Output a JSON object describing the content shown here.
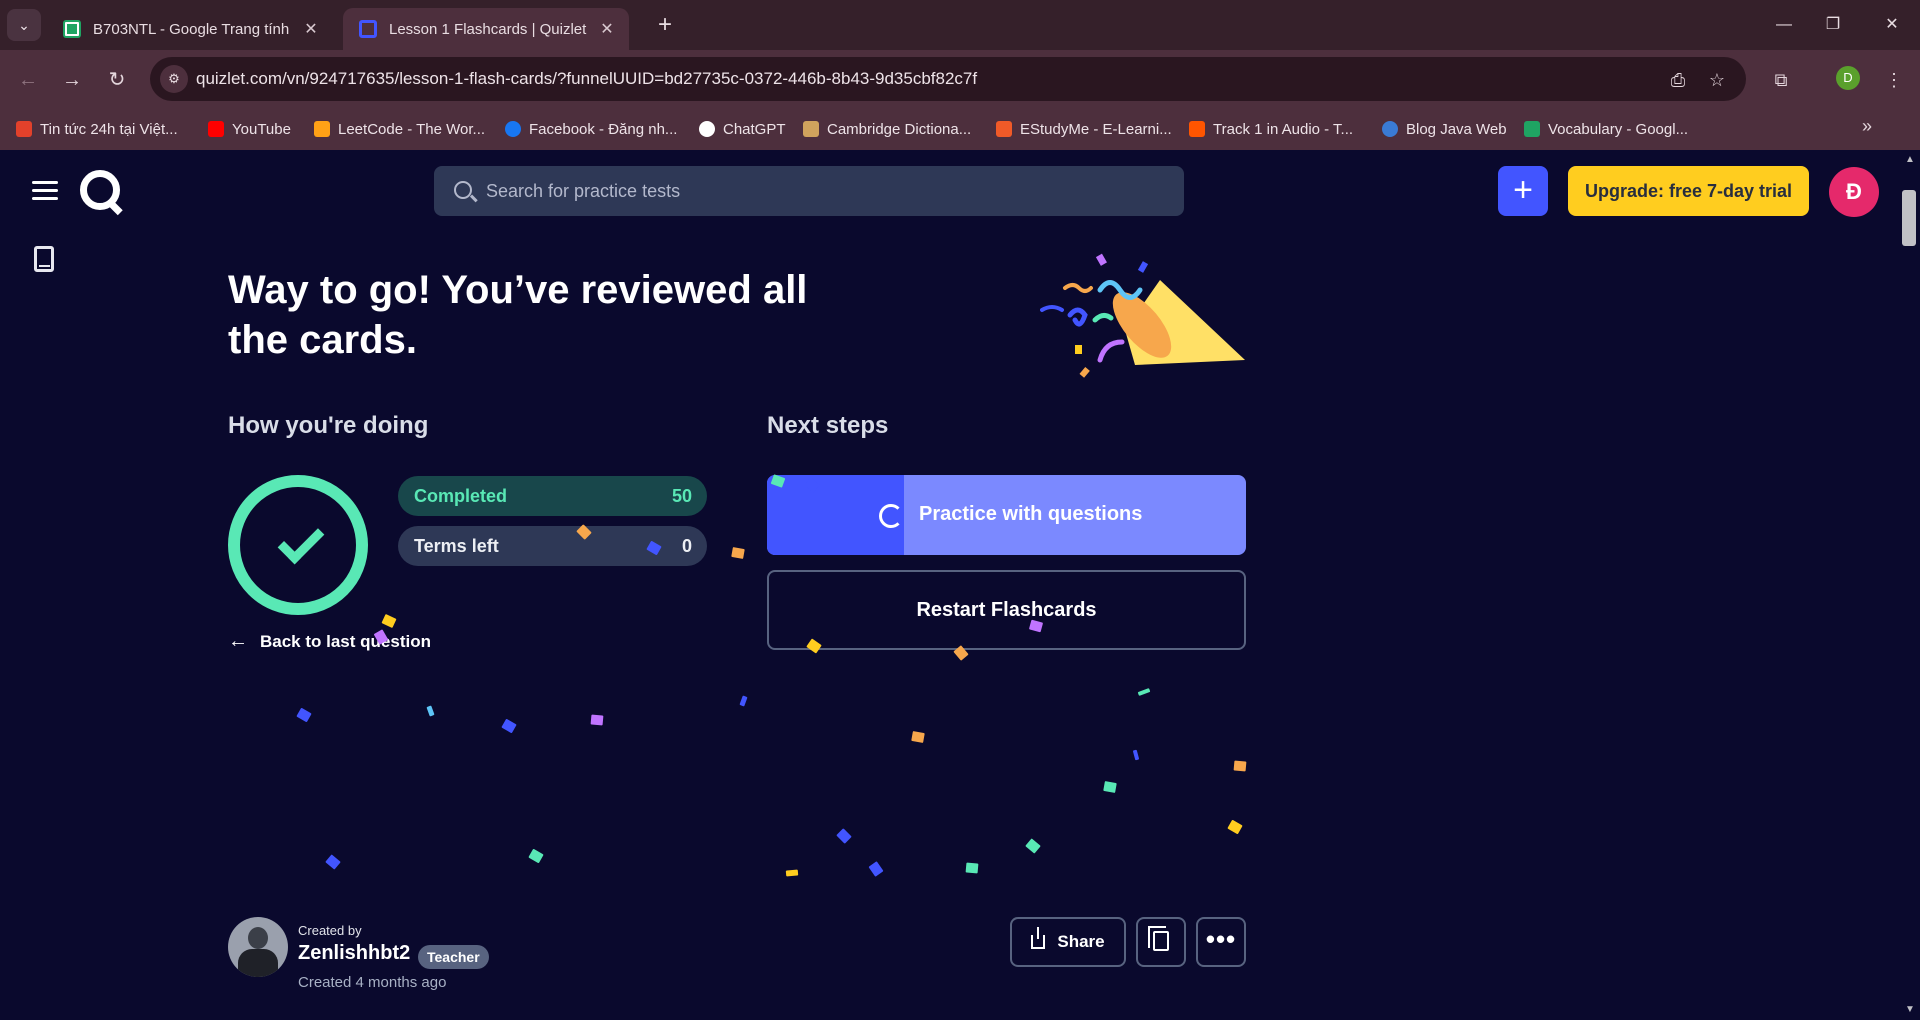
{
  "browser": {
    "tabs": [
      {
        "title": "B703NTL - Google Trang tính",
        "favicon": "sheets-icon"
      },
      {
        "title": "Lesson 1 Flashcards | Quizlet",
        "favicon": "quizlet-icon"
      }
    ],
    "url": "quizlet.com/vn/924717635/lesson-1-flash-cards/?funnelUUID=bd27735c-0372-446b-8b43-9d35cbf82c7f",
    "profile_initial": "D",
    "bookmarks": [
      {
        "label": "Tin tức 24h tại Việt...",
        "color": "#e2412b"
      },
      {
        "label": "YouTube",
        "color": "#ff0000"
      },
      {
        "label": "LeetCode - The Wor...",
        "color": "#ffa116"
      },
      {
        "label": "Facebook - Đăng nh...",
        "color": "#1877f2"
      },
      {
        "label": "ChatGPT",
        "color": "#ffffff"
      },
      {
        "label": "Cambridge Dictiona...",
        "color": "#d0a35d"
      },
      {
        "label": "EStudyMe - E-Learni...",
        "color": "#f05a28"
      },
      {
        "label": "Track 1 in Audio - T...",
        "color": "#ff5500"
      },
      {
        "label": "Blog Java Web",
        "color": "#3a7bd5"
      },
      {
        "label": "Vocabulary - Googl...",
        "color": "#1fa463"
      }
    ]
  },
  "header": {
    "search_placeholder": "Search for practice tests",
    "upgrade_label": "Upgrade: free 7-day trial",
    "avatar_initial": "Đ"
  },
  "main": {
    "headline": "Way to go! You’ve reviewed all the cards.",
    "progress": {
      "title": "How you're doing",
      "completed_label": "Completed",
      "completed_value": "50",
      "terms_left_label": "Terms left",
      "terms_left_value": "0",
      "back_label": "Back to last question"
    },
    "next_steps": {
      "title": "Next steps",
      "practice_label": "Practice with questions",
      "restart_label": "Restart Flashcards"
    }
  },
  "creator": {
    "created_by_label": "Created by",
    "name": "Zenlishhbt2",
    "badge": "Teacher",
    "created_ago": "Created 4 months ago",
    "share_label": "Share"
  },
  "colors": {
    "background": "#0a092d",
    "accent": "#4255ff",
    "upgrade": "#ffcd1f",
    "success": "#59e8b5"
  }
}
